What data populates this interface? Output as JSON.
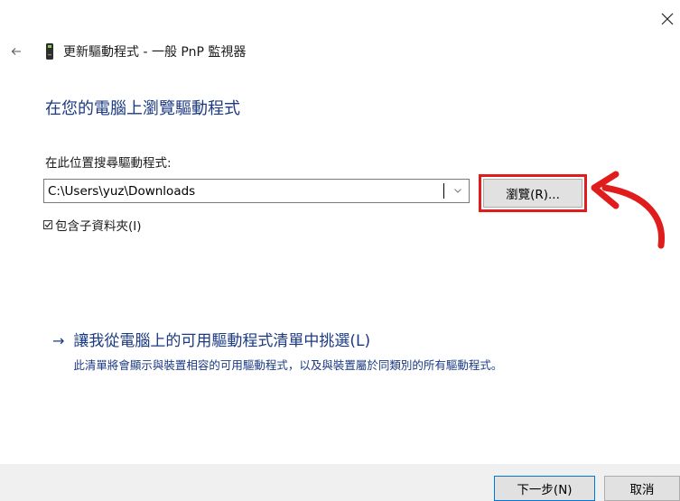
{
  "window": {
    "title": "更新驅動程式 - 一般 PnP 監視器",
    "close_icon": "close-icon",
    "back_icon": "back-arrow-icon",
    "device_icon": "monitor-device-icon"
  },
  "page": {
    "heading": "在您的電腦上瀏覽驅動程式",
    "search_label": "在此位置搜尋驅動程式:",
    "path_value": "C:\\Users\\yuz\\Downloads",
    "browse_label": "瀏覽(R)...",
    "include_subfolders_label": "包含子資料夾(I)",
    "include_subfolders_checked": true
  },
  "pick_option": {
    "arrow": "→",
    "title": "讓我從電腦上的可用驅動程式清單中挑選(L)",
    "description": "此清單將會顯示與裝置相容的可用驅動程式，以及與裝置屬於同類別的所有驅動程式。"
  },
  "footer": {
    "next_label": "下一步(N)",
    "cancel_label": "取消"
  },
  "colors": {
    "heading": "#1b3a83",
    "highlight": "#e01c1c",
    "default_button_border": "#0078d7",
    "button_face": "#e1e1e1",
    "footer_bg": "#f0f0f0"
  }
}
